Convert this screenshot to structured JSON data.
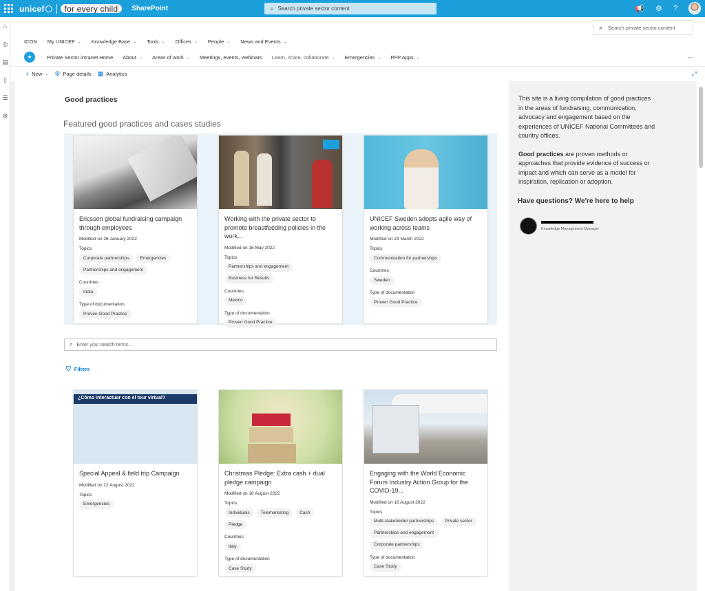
{
  "suite": {
    "brand_left": "unicef",
    "brand_right": "for every child",
    "app": "SharePoint",
    "search_placeholder": "Search private sector content"
  },
  "hub": {
    "search_placeholder": "Search private sector content",
    "nav": [
      {
        "label": "ICON"
      },
      {
        "label": "My UNICEF"
      },
      {
        "label": "Knowledge Base"
      },
      {
        "label": "Tools"
      },
      {
        "label": "Offices"
      },
      {
        "label": "People"
      },
      {
        "label": "News and Events"
      }
    ]
  },
  "site": {
    "nav": [
      {
        "label": "Private Sector intranet Home"
      },
      {
        "label": "About"
      },
      {
        "label": "Areas of work"
      },
      {
        "label": "Meetings, events, webinars"
      },
      {
        "label": "Learn, share, collaborate"
      },
      {
        "label": "Emergencies"
      },
      {
        "label": "PFP Apps"
      }
    ],
    "more": "···"
  },
  "commandbar": {
    "new": "New",
    "page_details": "Page details",
    "analytics": "Analytics"
  },
  "main": {
    "page_title": "Good practices",
    "featured_title": "Featured good practices and cases studies",
    "search_placeholder": "Enter your search terms...",
    "filters": "Filters"
  },
  "featured_cards": [
    {
      "title": "Ericsson global fundraising campaign through employees",
      "modified": "Modified on 26 January 2022",
      "topics_label": "Topics",
      "topics": [
        "Corporate partnerships",
        "Emergencies",
        "Partnerships and engagement"
      ],
      "countries_label": "Countries",
      "countries": [
        "India"
      ],
      "doctype_label": "Type of documentation",
      "doctype": [
        "Proven Good Practice"
      ]
    },
    {
      "title": "Working with the private sector to promote breastfeeding policies in the work...",
      "modified": "Modified on 16 May 2022",
      "topics_label": "Topics",
      "topics": [
        "Partnerships and engagement",
        "Business for Results"
      ],
      "countries_label": "Countries",
      "countries": [
        "Mexico"
      ],
      "doctype_label": "Type of documentation",
      "doctype": [
        "Proven Good Practice"
      ]
    },
    {
      "title": "UNICEF Sweden adopts agile way of working across teams",
      "modified": "Modified on 23 March 2022",
      "topics_label": "Topics",
      "topics": [
        "Communication for partnerships"
      ],
      "countries_label": "Countries",
      "countries": [
        "Sweden"
      ],
      "doctype_label": "Type of documentation",
      "doctype": [
        "Proven Good Practice"
      ]
    }
  ],
  "result_cards": [
    {
      "image_caption": "¿Cómo interactuar con el tour virtual?",
      "title": "Special Appeal & field trip Campaign",
      "modified": "Modified on 22 August 2022",
      "topics_label": "Topics",
      "topics": [
        "Emergencies"
      ]
    },
    {
      "title": "Christmas Pledge: Extra cash + dual pledge campaign",
      "modified": "Modified on 16 August 2022",
      "topics_label": "Topics",
      "topics": [
        "Individuals",
        "Telemarketing",
        "Cash",
        "Pledge"
      ],
      "countries_label": "Countries",
      "countries": [
        "Italy"
      ],
      "doctype_label": "Type of documentation",
      "doctype": [
        "Case Study"
      ]
    },
    {
      "title": "Engaging with the World Economic Forum Industry Action Group for the COVID-19...",
      "modified": "Modified on 16 August 2022",
      "topics_label": "Topics",
      "topics": [
        "Multi-stakeholder partnerships",
        "Private sector",
        "Partnerships and engagement",
        "Corporate partnerships"
      ],
      "doctype_label": "Type of documentation",
      "doctype": [
        "Case Study"
      ]
    }
  ],
  "aside": {
    "intro": "This site is a living compilation of good practices in the areas of fundraising, communication, advocacy and engagement based on the experiences of UNICEF National Committees and country offices.",
    "def_bold": "Good practices",
    "def_rest": " are proven methods or approaches that provide evidence of success or impact and which can serve as a model for inspiration, replication or adoption.",
    "questions": "Have questions? We're here to help",
    "contact_role": "Knowledge Management Manager"
  },
  "colors": {
    "suite_bar": "#1ca0dc",
    "link": "#0078d4",
    "featured_band": "#eaf3fa"
  }
}
